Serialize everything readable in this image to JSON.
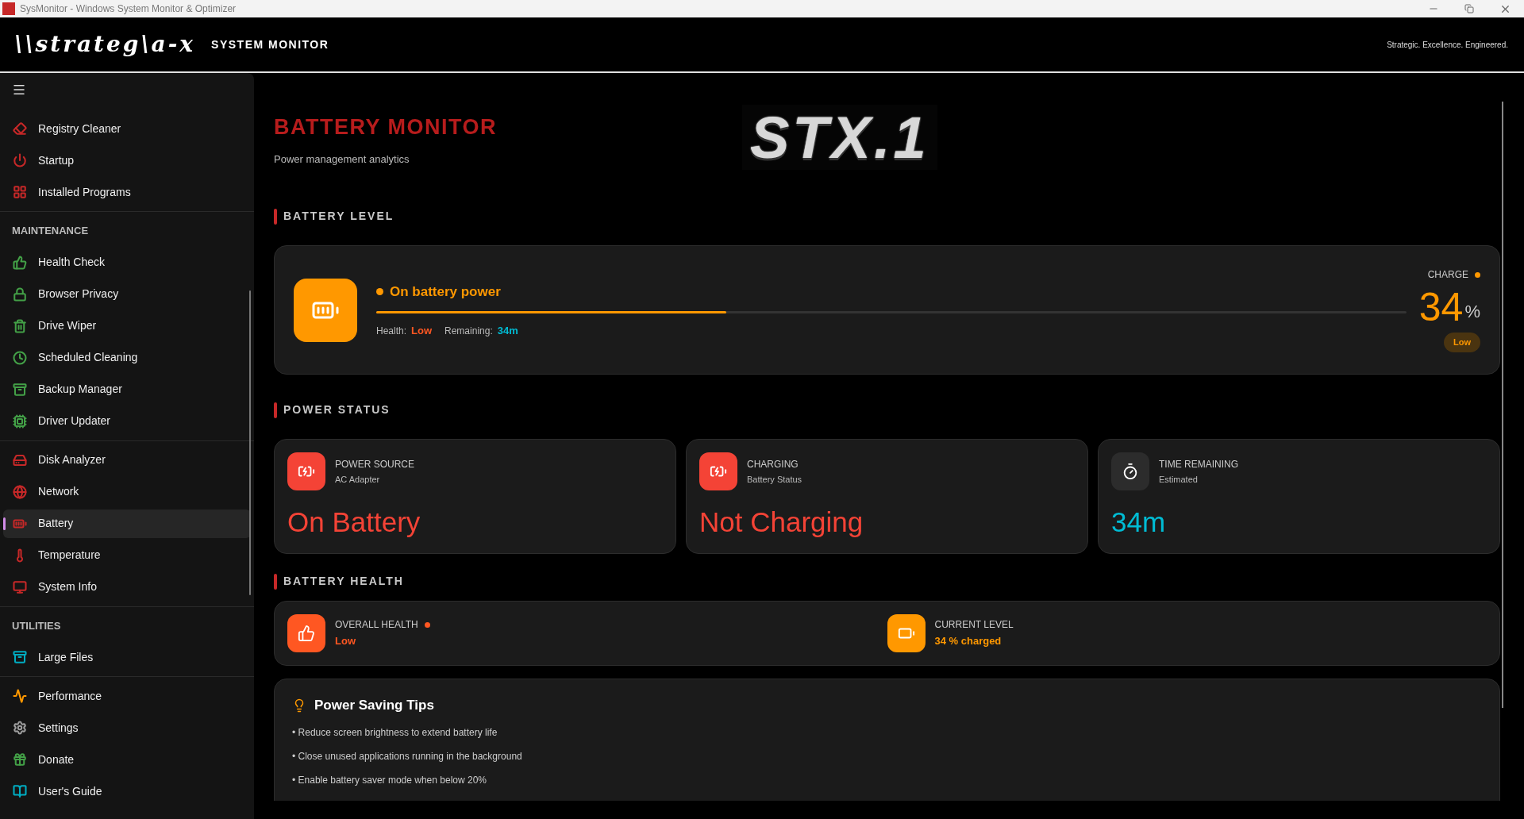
{
  "window": {
    "title": "SysMonitor - Windows System Monitor & Optimizer"
  },
  "header": {
    "logo": "\\\\strateg\\a-x",
    "title": "SYSTEM MONITOR",
    "tagline": "Strategic. Excellence. Engineered."
  },
  "sidebar": {
    "groups": [
      {
        "items": [
          {
            "label": "Registry Cleaner",
            "selected": false,
            "color": "#c62828"
          },
          {
            "label": "Startup",
            "selected": false,
            "color": "#c62828"
          },
          {
            "label": "Installed Programs",
            "selected": false,
            "color": "#c62828"
          }
        ]
      },
      {
        "heading": "MAINTENANCE",
        "items": [
          {
            "label": "Health Check",
            "selected": false,
            "color": "#43a047"
          },
          {
            "label": "Browser Privacy",
            "selected": false,
            "color": "#43a047"
          },
          {
            "label": "Drive Wiper",
            "selected": false,
            "color": "#43a047"
          },
          {
            "label": "Scheduled Cleaning",
            "selected": false,
            "color": "#43a047"
          },
          {
            "label": "Backup Manager",
            "selected": false,
            "color": "#43a047"
          },
          {
            "label": "Driver Updater",
            "selected": false,
            "color": "#43a047"
          }
        ]
      },
      {
        "items": [
          {
            "label": "Disk Analyzer",
            "selected": false,
            "color": "#c62828"
          },
          {
            "label": "Network",
            "selected": false,
            "color": "#c62828"
          },
          {
            "label": "Battery",
            "selected": true,
            "color": "#c62828"
          },
          {
            "label": "Temperature",
            "selected": false,
            "color": "#c62828"
          },
          {
            "label": "System Info",
            "selected": false,
            "color": "#c62828"
          }
        ]
      },
      {
        "heading": "UTILITIES",
        "items": [
          {
            "label": "Large Files",
            "selected": false,
            "color": "#00acc1"
          }
        ]
      },
      {
        "items": [
          {
            "label": "Performance",
            "selected": false,
            "color": "#ff9800"
          },
          {
            "label": "Settings",
            "selected": false,
            "color": "#9e9e9e"
          },
          {
            "label": "Donate",
            "selected": false,
            "color": "#43a047"
          },
          {
            "label": "User's Guide",
            "selected": false,
            "color": "#00acc1"
          }
        ]
      }
    ]
  },
  "page": {
    "title": "BATTERY MONITOR",
    "subtitle": "Power management analytics",
    "logo": "STX.1"
  },
  "battery_level": {
    "heading": "BATTERY LEVEL",
    "status": "On battery power",
    "level": 0.34,
    "health_label": "Health:",
    "health_value": "Low",
    "remaining_label": "Remaining:",
    "remaining_value": "34m",
    "charge_label": "CHARGE",
    "charge_value": "34",
    "charge_unit": "%",
    "badge": "Low"
  },
  "power_status": {
    "heading": "POWER STATUS",
    "cards": [
      {
        "kind": "source",
        "title": "POWER SOURCE",
        "subtitle": "AC Adapter",
        "value": "On Battery",
        "color": "#f44336"
      },
      {
        "kind": "charging",
        "title": "CHARGING",
        "subtitle": "Battery Status",
        "value": "Not Charging",
        "color": "#f44336"
      },
      {
        "kind": "time",
        "title": "TIME REMAINING",
        "subtitle": "Estimated",
        "value": "34m",
        "color": "#00bcd4"
      }
    ]
  },
  "battery_health": {
    "heading": "BATTERY HEALTH",
    "items": [
      {
        "kind": "health",
        "title": "OVERALL HEALTH",
        "value": "Low",
        "color": "#ff5722"
      },
      {
        "kind": "level",
        "title": "CURRENT LEVEL",
        "value": "34 % charged",
        "color": "#ff9800"
      }
    ]
  },
  "tips": {
    "title": "Power Saving Tips",
    "items": [
      "• Reduce screen brightness to extend battery life",
      "• Close unused applications running in the background",
      "• Enable battery saver mode when below 20%"
    ]
  }
}
